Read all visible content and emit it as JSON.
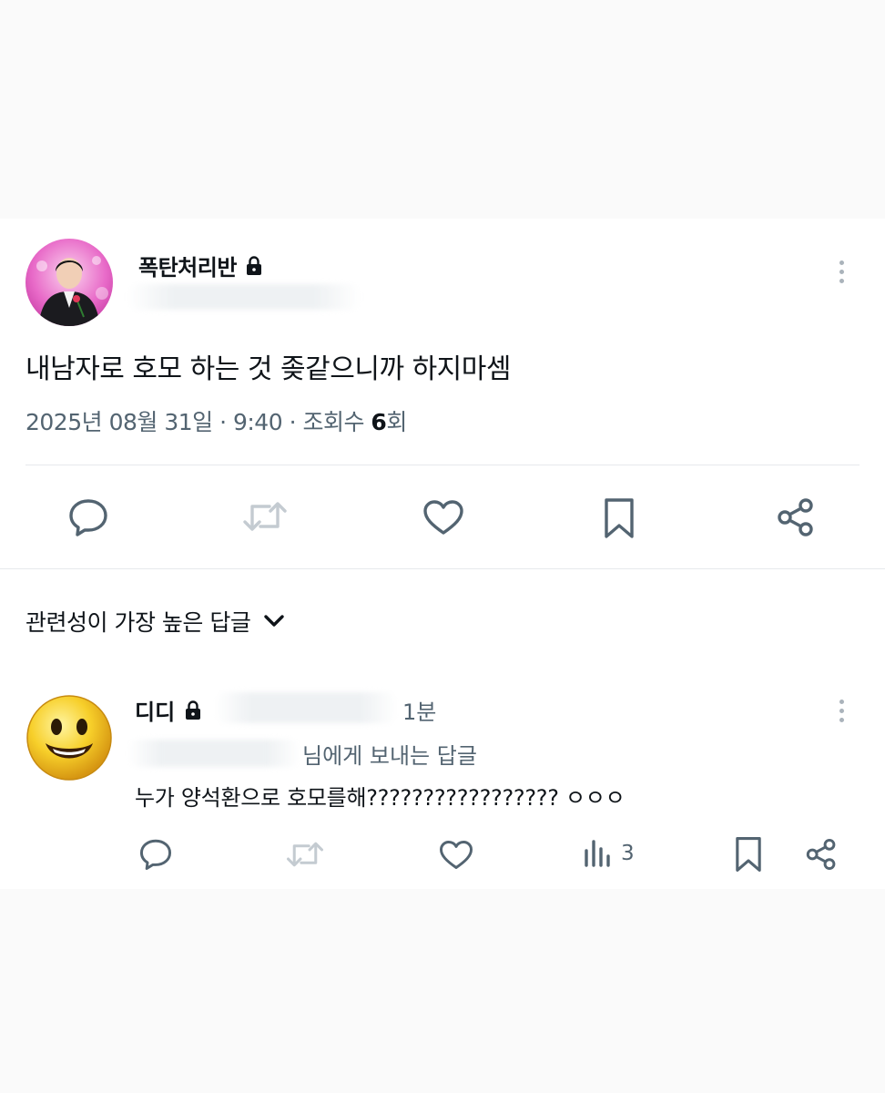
{
  "post": {
    "author_name": "폭탄처리반",
    "text": "내남자로 호모 하는 것 좆같으니까 하지마셈",
    "meta_prefix": "2025년 08월 31일 · 9:40 · 조회수 ",
    "views_count": "6",
    "views_suffix": "회",
    "actions": [
      "reply-icon",
      "retweet-icon",
      "like-icon",
      "bookmark-icon",
      "share-icon"
    ]
  },
  "replies_section": {
    "sort_label": "관련성이 가장 높은 답글"
  },
  "reply": {
    "author_name": "디디",
    "time": "1분",
    "replying_to": "님에게 보내는 답글",
    "text": "누가 양석환으로 호모를해????????????????? ㅇㅇㅇ",
    "views_count": "3"
  },
  "colors": {
    "text": "#0f1419",
    "secondary": "#536471",
    "background": "#fafafa",
    "card": "#ffffff",
    "divider": "#e6e9ec"
  }
}
